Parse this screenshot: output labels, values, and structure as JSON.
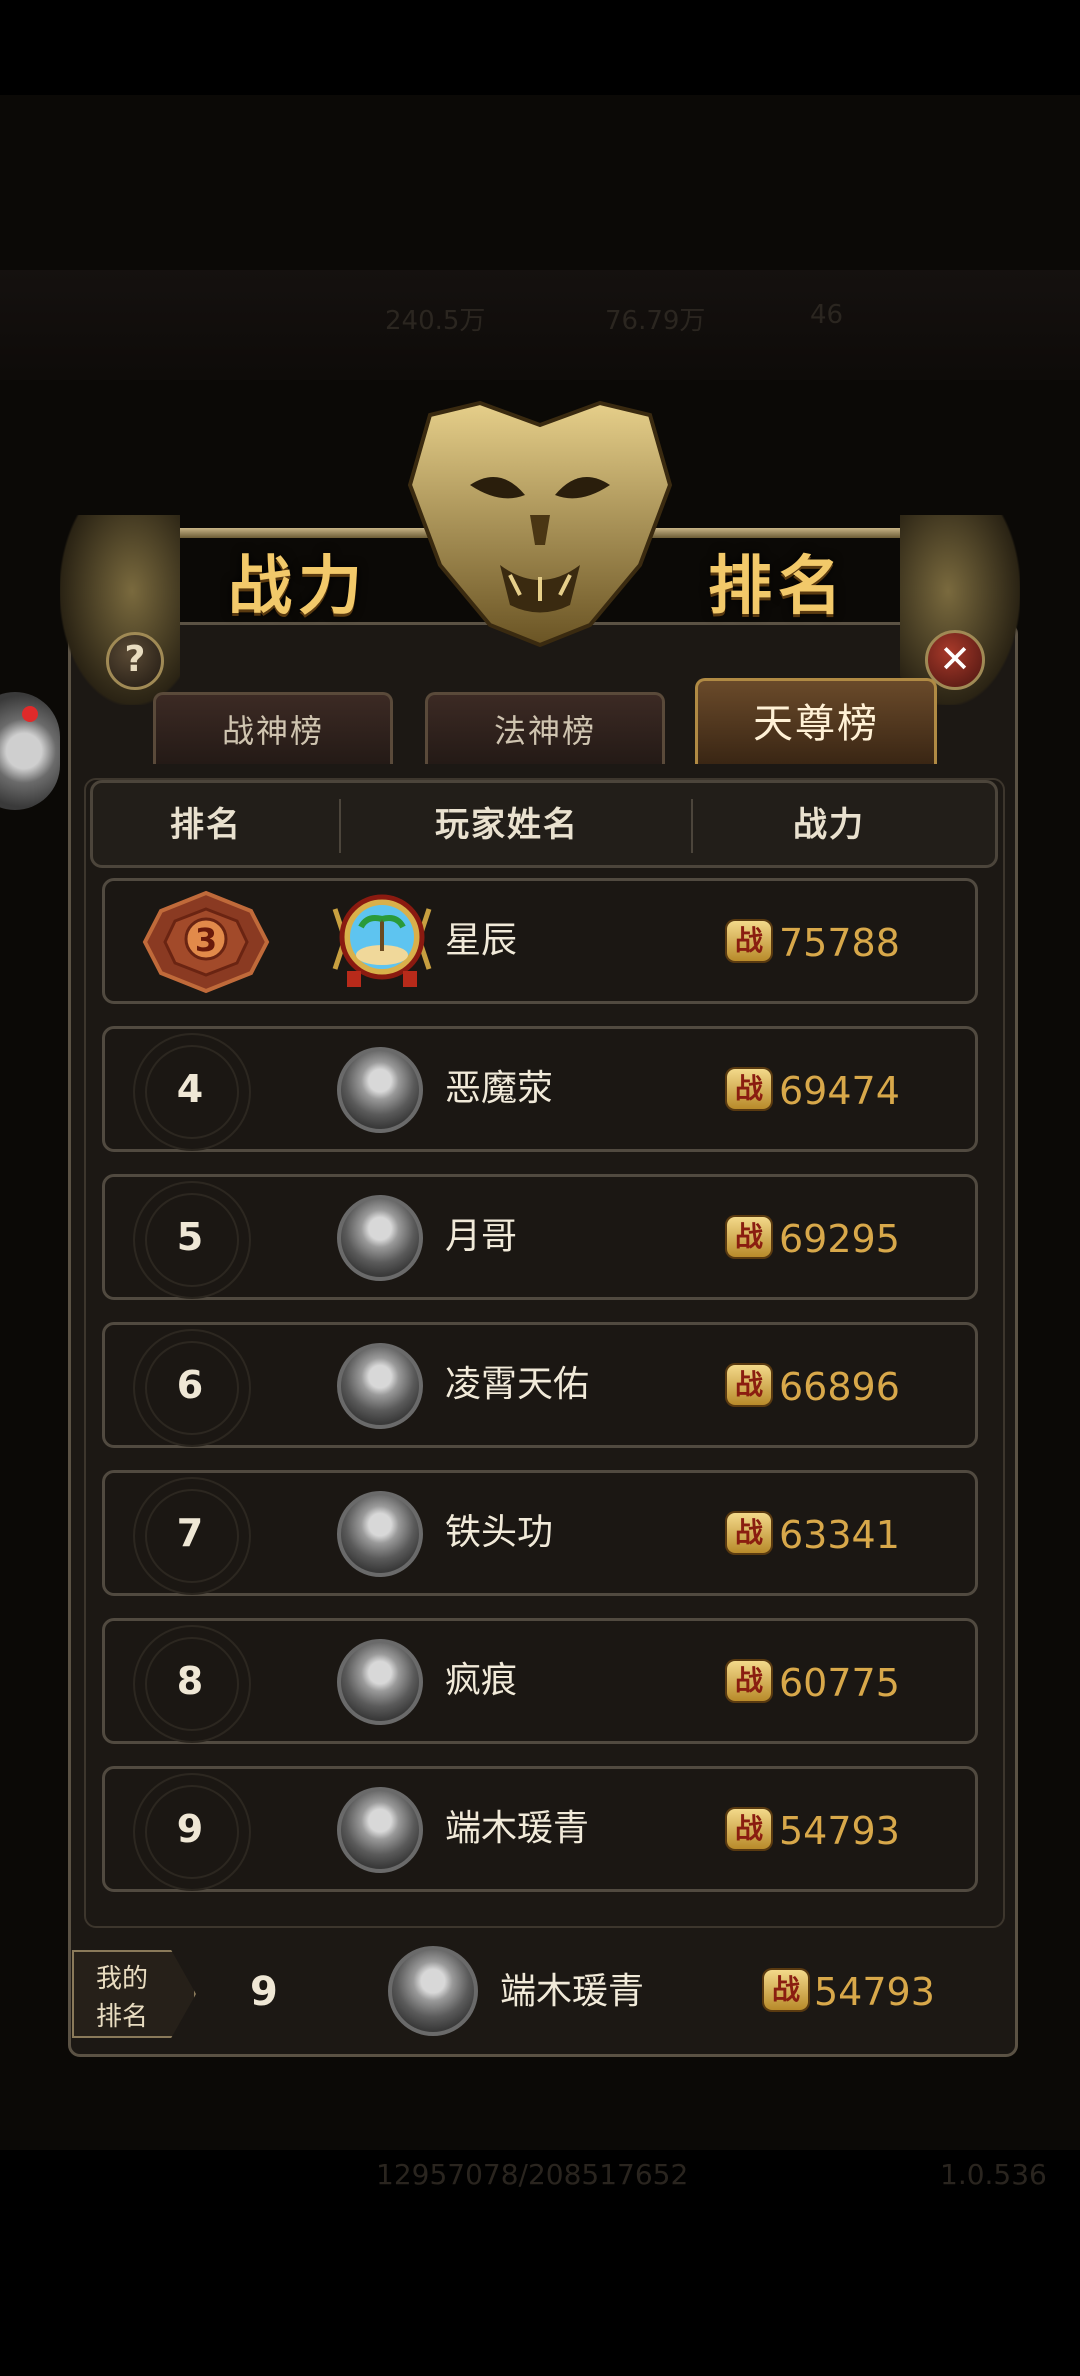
{
  "hud": {
    "stat_1": "240.5万",
    "stat_2": "76.79万",
    "stat_3": "46",
    "footer_numbers": "12957078/208517652",
    "version": "1.0.536"
  },
  "title": {
    "left": "战力",
    "right": "排名"
  },
  "buttons": {
    "help": "?",
    "close": "✕"
  },
  "tabs": [
    {
      "label": "战神榜",
      "active": false
    },
    {
      "label": "法神榜",
      "active": false
    },
    {
      "label": "天尊榜",
      "active": true
    }
  ],
  "table_header": {
    "rank": "排名",
    "player_name": "玩家姓名",
    "power": "战力"
  },
  "power_icon_label": "战",
  "rows": [
    {
      "rank": "3",
      "name": "星辰",
      "power": "75788"
    },
    {
      "rank": "4",
      "name": "恶魔荥",
      "power": "69474"
    },
    {
      "rank": "5",
      "name": "月哥",
      "power": "69295"
    },
    {
      "rank": "6",
      "name": "凌霄天佑",
      "power": "66896"
    },
    {
      "rank": "7",
      "name": "铁头功",
      "power": "63341"
    },
    {
      "rank": "8",
      "name": "疯痕",
      "power": "60775"
    },
    {
      "rank": "9",
      "name": "端木瑗青",
      "power": "54793"
    }
  ],
  "my_rank": {
    "label_line1": "我的",
    "label_line2": "排名",
    "rank": "9",
    "name": "端木瑗青",
    "power": "54793"
  },
  "colors": {
    "gold": "#d8a84a",
    "panel": "#1c1814",
    "title": "#f2c96a"
  }
}
